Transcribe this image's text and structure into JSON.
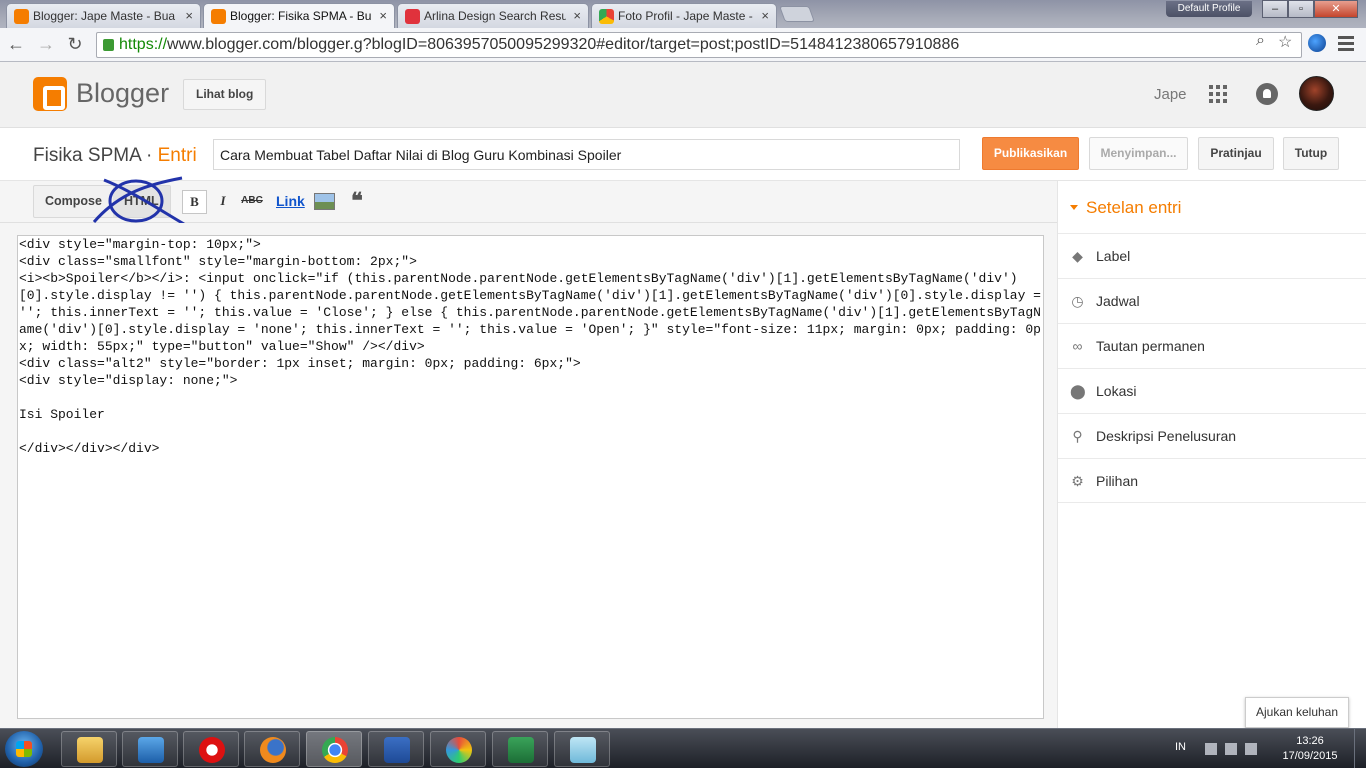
{
  "browser": {
    "tabs": [
      {
        "title": "Blogger: Jape Maste - Bua",
        "color": "#f57d00"
      },
      {
        "title": "Blogger: Fisika SPMA - Bu",
        "color": "#f57d00",
        "active": true
      },
      {
        "title": "Arlina Design Search Resu",
        "color": "#e0323c"
      },
      {
        "title": "Foto Profil - Jape Maste -",
        "color": "#3a8ee6"
      }
    ],
    "profile_label": "Default Profile",
    "url_scheme": "https://",
    "url_rest": "www.blogger.com/blogger.g?blogID=8063957050095299320#editor/target=post;postID=5148412380657910886"
  },
  "header": {
    "brand": "Blogger",
    "view_blog": "Lihat blog",
    "user": "Jape"
  },
  "post": {
    "blog_name": "Fisika SPMA",
    "separator": "·",
    "section": "Entri",
    "title_value": "Cara Membuat Tabel Daftar Nilai di Blog Guru Kombinasi Spoiler",
    "publish": "Publikasikan",
    "saving": "Menyimpan...",
    "preview": "Pratinjau",
    "close": "Tutup"
  },
  "editor": {
    "compose": "Compose",
    "html": "HTML",
    "bold": "B",
    "italic": "I",
    "strike": "ABC",
    "link": "Link",
    "quote": "❝",
    "code_lines": [
      "<div style=\"margin-top: 10px;\">",
      "<div class=\"smallfont\" style=\"margin-bottom: 2px;\">",
      "<i><b>Spoiler</b></i>: <input onclick=\"if (this.parentNode.parentNode.getElementsByTagName('div')[1].getElementsByTagName('div')[0].style.display != '') { this.parentNode.parentNode.getElementsByTagName('div')[1].getElementsByTagName('div')[0].style.display = ''; this.innerText = ''; this.value = 'Close'; } else { this.parentNode.parentNode.getElementsByTagName('div')[1].getElementsByTagName('div')[0].style.display = 'none'; this.innerText = ''; this.value = 'Open'; }\" style=\"font-size: 11px; margin: 0px; padding: 0px; width: 55px;\" type=\"button\" value=\"Show\" /></div>",
      "<div class=\"alt2\" style=\"border: 1px inset; margin: 0px; padding: 6px;\">",
      "<div style=\"display: none;\">",
      "",
      "Isi Spoiler",
      "",
      "</div></div></div>"
    ]
  },
  "sidebar": {
    "heading": "Setelan entri",
    "items": [
      {
        "label": "Label",
        "icon": "tag-icon"
      },
      {
        "label": "Jadwal",
        "icon": "clock-icon"
      },
      {
        "label": "Tautan permanen",
        "icon": "link-icon"
      },
      {
        "label": "Lokasi",
        "icon": "location-pin-icon"
      },
      {
        "label": "Deskripsi Penelusuran",
        "icon": "search-icon"
      },
      {
        "label": "Pilihan",
        "icon": "gear-icon"
      }
    ]
  },
  "feedback": "Ajukan keluhan",
  "taskbar": {
    "language": "IN",
    "time": "13:26",
    "date": "17/09/2015"
  }
}
